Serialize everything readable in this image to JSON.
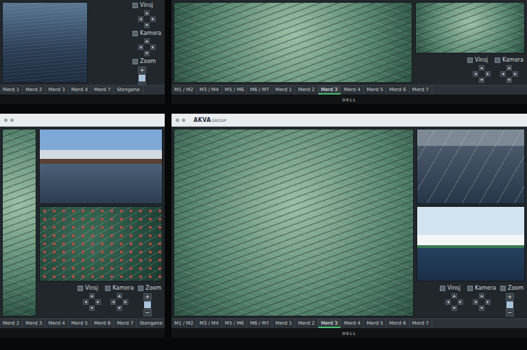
{
  "monitors": [
    {
      "name": "top-left",
      "kind": "fullscreen",
      "logo": [],
      "main_feeds": [
        {
          "kind": "surface"
        }
      ],
      "side_feeds": [],
      "controls": [
        {
          "label": "Vinsj",
          "kind": "pad"
        },
        {
          "label": "Kamera",
          "kind": "pad"
        },
        {
          "label": "Zoom",
          "kind": "zoom",
          "plus": "+",
          "minus": "−"
        }
      ],
      "tabs": [
        {
          "label": "Merd 1",
          "selected": false
        },
        {
          "label": "Merd 2",
          "selected": false
        },
        {
          "label": "Merd 3",
          "selected": false
        },
        {
          "label": "Merd 4",
          "selected": false
        },
        {
          "label": "Merd 7",
          "selected": false
        },
        {
          "label": "Stengene",
          "selected": false
        }
      ]
    },
    {
      "name": "top-right",
      "kind": "fullscreen",
      "logo": [],
      "brand": "DELL",
      "main_feeds": [
        {
          "kind": "underwater"
        }
      ],
      "side_feeds": [
        {
          "kind": "underwater"
        }
      ],
      "controls": [
        {
          "label": "Vinsj",
          "kind": "pad"
        },
        {
          "label": "Kamera",
          "kind": "pad"
        }
      ],
      "tabs": [
        {
          "label": "M1 / M2",
          "selected": false
        },
        {
          "label": "M3 / M4",
          "selected": false
        },
        {
          "label": "M5 / M6",
          "selected": false
        },
        {
          "label": "M6 / M7",
          "selected": false
        },
        {
          "label": "Merd 1",
          "selected": false
        },
        {
          "label": "Merd 2",
          "selected": false
        },
        {
          "label": "Merd 3",
          "selected": true
        },
        {
          "label": "Merd 4",
          "selected": false
        },
        {
          "label": "Merd 5",
          "selected": false
        },
        {
          "label": "Merd 6",
          "selected": false
        },
        {
          "label": "Merd 7",
          "selected": false
        }
      ]
    },
    {
      "name": "bottom-left",
      "kind": "browser",
      "logo": [],
      "main_feeds": [
        {
          "kind": "underwater"
        }
      ],
      "side_feeds": [
        {
          "kind": "pen-sky"
        },
        {
          "kind": "underwater-dark"
        }
      ],
      "controls": [
        {
          "label": "Vinsj",
          "kind": "pad"
        },
        {
          "label": "Kamera",
          "kind": "pad"
        },
        {
          "label": "Zoom",
          "kind": "zoom",
          "plus": "+",
          "minus": "−"
        }
      ],
      "tabs": [
        {
          "label": "Merd 2",
          "selected": false
        },
        {
          "label": "Merd 3",
          "selected": false
        },
        {
          "label": "Merd 4",
          "selected": false
        },
        {
          "label": "Merd 5",
          "selected": false
        },
        {
          "label": "Merd 6",
          "selected": false
        },
        {
          "label": "Merd 7",
          "selected": false
        },
        {
          "label": "Stengene",
          "selected": false
        }
      ]
    },
    {
      "name": "bottom-right",
      "kind": "browser",
      "logo": [
        "AKVA",
        "GROUP"
      ],
      "brand": "DELL",
      "main_feeds": [
        {
          "kind": "underwater"
        }
      ],
      "side_feeds": [
        {
          "kind": "pen"
        },
        {
          "kind": "landscape"
        }
      ],
      "controls": [
        {
          "label": "Vinsj",
          "kind": "pad"
        },
        {
          "label": "Kamera",
          "kind": "pad"
        },
        {
          "label": "Zoom",
          "kind": "zoom",
          "plus": "+",
          "minus": "−"
        }
      ],
      "tabs": [
        {
          "label": "M1 / M2",
          "selected": false
        },
        {
          "label": "M3 / M4",
          "selected": false
        },
        {
          "label": "M5 / M6",
          "selected": false
        },
        {
          "label": "M6 / M7",
          "selected": false
        },
        {
          "label": "Merd 1",
          "selected": false
        },
        {
          "label": "Merd 2",
          "selected": false
        },
        {
          "label": "Merd 3",
          "selected": true
        },
        {
          "label": "Merd 4",
          "selected": false
        },
        {
          "label": "Merd 5",
          "selected": false
        },
        {
          "label": "Merd 6",
          "selected": false
        },
        {
          "label": "Merd 7",
          "selected": false
        }
      ]
    }
  ]
}
